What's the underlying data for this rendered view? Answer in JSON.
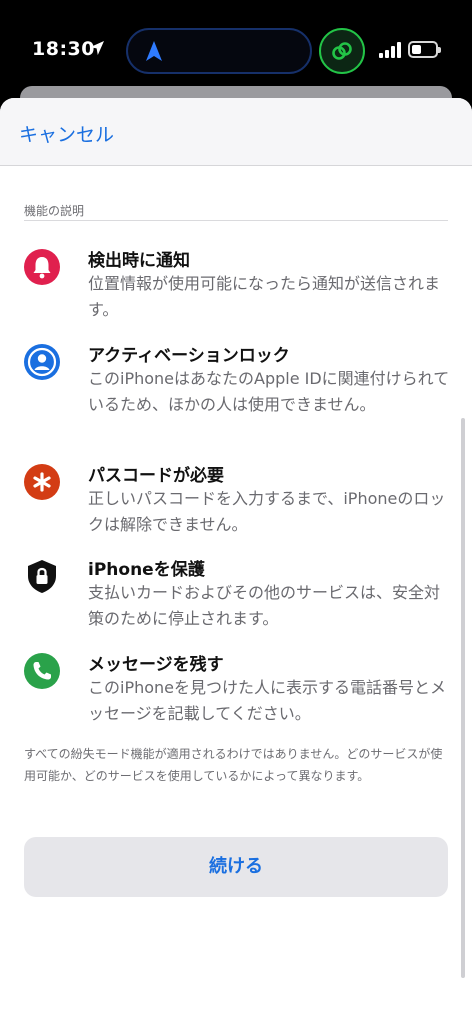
{
  "status_bar": {
    "time": "18:30",
    "battery_level": 0.3,
    "signal_bars": 4
  },
  "header": {
    "cancel_label": "キャンセル"
  },
  "section": {
    "label": "機能の説明"
  },
  "features": [
    {
      "icon": "bell-icon",
      "color": "#e0204e",
      "title": "検出時に通知",
      "description": "位置情報が使用可能になったら通知が送信されます。"
    },
    {
      "icon": "person-icon",
      "color": "#1a6fe0",
      "title": "アクティベーションロック",
      "description": "このiPhoneはあなたのApple IDに関連付けられているため、ほかの人は使用できません。"
    },
    {
      "icon": "asterisk-icon",
      "color": "#d33c14",
      "title": "パスコードが必要",
      "description": "正しいパスコードを入力するまで、iPhoneのロックは解除できません。"
    },
    {
      "icon": "shield-lock-icon",
      "color": "#111111",
      "title": "iPhoneを保護",
      "description": "支払いカードおよびその他のサービスは、安全対策のために停止されます。"
    },
    {
      "icon": "phone-icon",
      "color": "#2aa24a",
      "title": "メッセージを残す",
      "description": "このiPhoneを見つけた人に表示する電話番号とメッセージを記載してください。"
    }
  ],
  "footnote": "すべての紛失モード機能が適用されるわけではありません。どのサービスが使用可能か、どのサービスを使用しているかによって異なります。",
  "continue_label": "続ける",
  "colors": {
    "accent": "#1a6fe0",
    "shortcut_ring": "#23c447"
  }
}
